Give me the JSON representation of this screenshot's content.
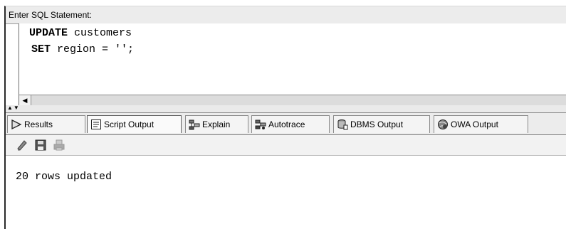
{
  "sql_panel": {
    "header_label": "Enter SQL Statement:",
    "code": {
      "line1_keyword": "UPDATE",
      "line1_rest": " customers",
      "line2_keyword": "SET",
      "line2_rest": " region = '';"
    }
  },
  "tabs": [
    {
      "label": "Results",
      "icon": "run-arrow-icon",
      "active": false
    },
    {
      "label": "Script Output",
      "icon": "script-output-icon",
      "active": true
    },
    {
      "label": "Explain",
      "icon": "explain-plan-icon",
      "active": false
    },
    {
      "label": "Autotrace",
      "icon": "autotrace-icon",
      "active": false
    },
    {
      "label": "DBMS Output",
      "icon": "dbms-output-icon",
      "active": false
    },
    {
      "label": "OWA Output",
      "icon": "owa-output-icon",
      "active": false
    }
  ],
  "toolbar": {
    "icons": [
      "eraser-icon",
      "save-icon",
      "print-icon"
    ]
  },
  "output": {
    "text": "20 rows updated"
  }
}
